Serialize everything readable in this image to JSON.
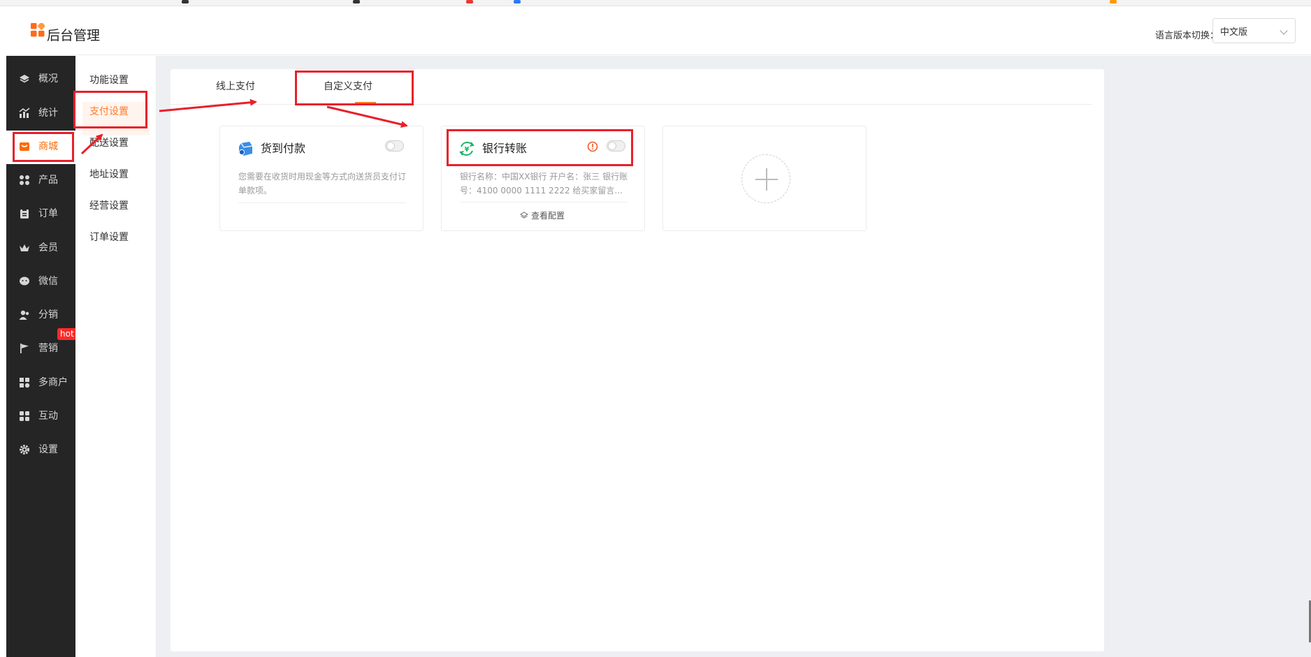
{
  "header": {
    "title": "后台管理",
    "language_label": "语言版本切换：",
    "language_value": "中文版"
  },
  "sidebar": {
    "items": [
      {
        "label": "概况",
        "icon": "layers-icon"
      },
      {
        "label": "统计",
        "icon": "stats-icon"
      },
      {
        "label": "商城",
        "icon": "shop-icon"
      },
      {
        "label": "产品",
        "icon": "grid-icon"
      },
      {
        "label": "订单",
        "icon": "clipboard-icon"
      },
      {
        "label": "会员",
        "icon": "crown-icon"
      },
      {
        "label": "微信",
        "icon": "wechat-icon"
      },
      {
        "label": "分销",
        "icon": "users-icon"
      },
      {
        "label": "营销",
        "icon": "flag-icon"
      },
      {
        "label": "多商户",
        "icon": "store-icon"
      },
      {
        "label": "互动",
        "icon": "apps-icon"
      },
      {
        "label": "设置",
        "icon": "gear-icon"
      }
    ],
    "active_index": 2,
    "hot_badge": "hot"
  },
  "submenu": {
    "items": [
      "功能设置",
      "支付设置",
      "配送设置",
      "地址设置",
      "经营设置",
      "订单设置"
    ],
    "active_index": 1
  },
  "tabs": {
    "items": [
      "线上支付",
      "自定义支付"
    ],
    "active_index": 1
  },
  "cards": [
    {
      "title": "货到付款",
      "icon": "cash-on-delivery-icon",
      "description": "您需要在收货时用现金等方式向送货员支付订单款项。",
      "enabled": false
    },
    {
      "title": "银行转账",
      "icon": "bank-transfer-icon",
      "description": "银行名称：中国XX银行 开户名：张三 银行账号：4100 0000 1111 2222 给买家留言...",
      "link": "查看配置",
      "link_icon": "layers-icon",
      "warning_icon": "warning-icon",
      "enabled": false
    }
  ],
  "add_card": {
    "icon": "plus-icon"
  },
  "colors": {
    "accent": "#ff7a2d",
    "sidebar_bg": "#252525",
    "highlight": "#e8202a",
    "content_bg": "#eeeff2"
  }
}
